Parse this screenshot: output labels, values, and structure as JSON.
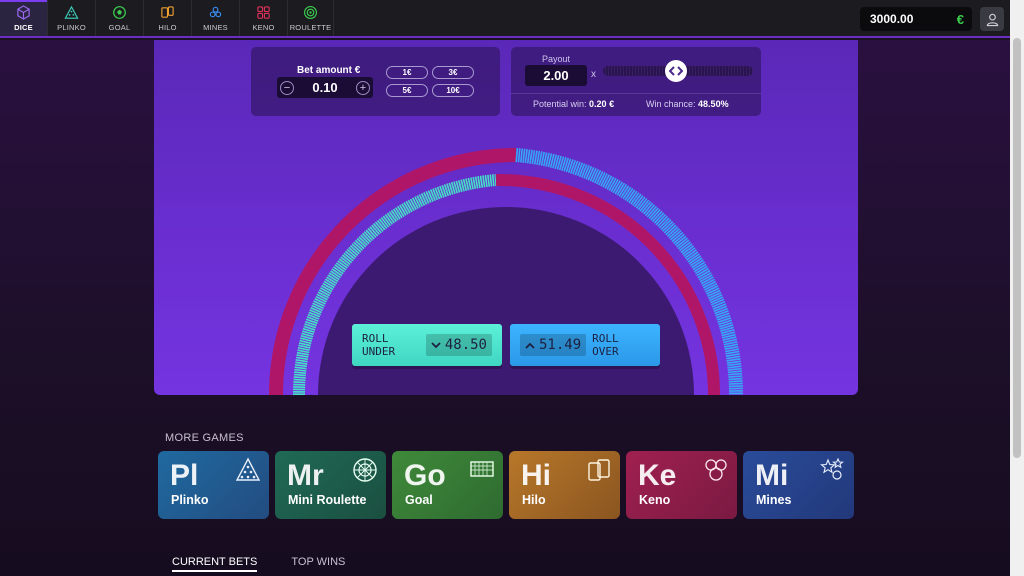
{
  "nav": {
    "items": [
      {
        "label": "DICE",
        "icon": "dice-icon"
      },
      {
        "label": "PLINKO",
        "icon": "plinko-icon"
      },
      {
        "label": "GOAL",
        "icon": "ball-icon"
      },
      {
        "label": "HILO",
        "icon": "hilo-icon"
      },
      {
        "label": "MINES",
        "icon": "mines-icon"
      },
      {
        "label": "KENO",
        "icon": "keno-icon"
      },
      {
        "label": "ROULETTE",
        "icon": "roulette-icon"
      }
    ]
  },
  "balance": {
    "amount": "3000.00",
    "currency": "€"
  },
  "bet": {
    "label": "Bet amount €",
    "value": "0.10",
    "minus": "−",
    "plus": "+",
    "quick": [
      "1€",
      "3€",
      "5€",
      "10€"
    ]
  },
  "payout": {
    "label": "Payout",
    "value": "2.00",
    "x": "x",
    "potential_label": "Potential win:",
    "potential_value": "0.20 €",
    "chance_label": "Win chance:",
    "chance_value": "48.50%",
    "slider_fraction": 0.485
  },
  "roll": {
    "under_label": "ROLL UNDER",
    "under_value": "48.50",
    "over_label": "ROLL OVER",
    "over_value": "51.49"
  },
  "more_games": {
    "title": "MORE GAMES",
    "cards": [
      {
        "abbr": "Pl",
        "name": "Plinko",
        "icon": "plinko-pyramid-icon"
      },
      {
        "abbr": "Mr",
        "name": "Mini Roulette",
        "icon": "roulette-wheel-icon"
      },
      {
        "abbr": "Go",
        "name": "Goal",
        "icon": "goal-net-icon"
      },
      {
        "abbr": "Hi",
        "name": "Hilo",
        "icon": "cards-icon"
      },
      {
        "abbr": "Ke",
        "name": "Keno",
        "icon": "keno-balls-icon"
      },
      {
        "abbr": "Mi",
        "name": "Mines",
        "icon": "stars-icon"
      }
    ]
  },
  "tabs": [
    "CURRENT BETS",
    "TOP WINS"
  ],
  "colors": {
    "accent": "#7a3df0",
    "under": "#46e0c8",
    "over": "#36a8f5",
    "arc_red": "#b01668",
    "balance_currency": "#3ccf4e"
  }
}
